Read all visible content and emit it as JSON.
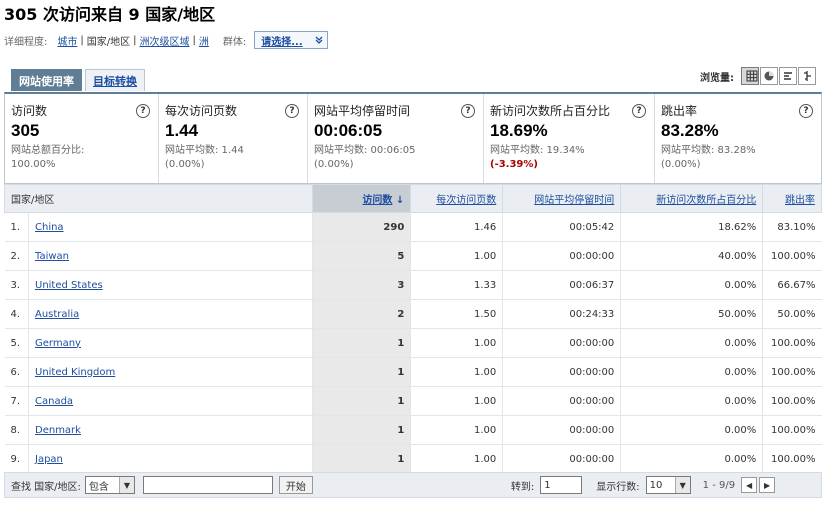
{
  "header": {
    "title": "305 次访问来自 9 国家/地区",
    "detail_label": "详细程度:",
    "levels": [
      "城市",
      "国家/地区",
      "洲次级区域",
      "洲"
    ],
    "segment_label": "群体:",
    "segment_value": "请选择..."
  },
  "tabs": [
    "网站使用率",
    "目标转换"
  ],
  "view_label": "浏览量:",
  "metrics": [
    {
      "name": "访问数",
      "value": "305",
      "sub1": "网站总额百分比:",
      "sub2": "100.00%"
    },
    {
      "name": "每次访问页数",
      "value": "1.44",
      "sub1": "网站平均数: 1.44",
      "sub2": "(0.00%)"
    },
    {
      "name": "网站平均停留时间",
      "value": "00:06:05",
      "sub1": "网站平均数: 00:06:05",
      "sub2": "(0.00%)"
    },
    {
      "name": "新访问次数所占百分比",
      "value": "18.69%",
      "sub1": "网站平均数: 19.34%",
      "sub2": "(-3.39%)"
    },
    {
      "name": "跳出率",
      "value": "83.28%",
      "sub1": "网站平均数: 83.28%",
      "sub2": "(0.00%)"
    }
  ],
  "table": {
    "columns": [
      "国家/地区",
      "访问数",
      "每次访问页数",
      "网站平均停留时间",
      "新访问次数所占百分比",
      "跳出率"
    ],
    "rows": [
      {
        "idx": "1.",
        "country": "China",
        "visits": "290",
        "pages": "1.46",
        "time": "00:05:42",
        "new": "18.62%",
        "bounce": "83.10%"
      },
      {
        "idx": "2.",
        "country": "Taiwan",
        "visits": "5",
        "pages": "1.00",
        "time": "00:00:00",
        "new": "40.00%",
        "bounce": "100.00%"
      },
      {
        "idx": "3.",
        "country": "United States",
        "visits": "3",
        "pages": "1.33",
        "time": "00:06:37",
        "new": "0.00%",
        "bounce": "66.67%"
      },
      {
        "idx": "4.",
        "country": "Australia",
        "visits": "2",
        "pages": "1.50",
        "time": "00:24:33",
        "new": "50.00%",
        "bounce": "50.00%"
      },
      {
        "idx": "5.",
        "country": "Germany",
        "visits": "1",
        "pages": "1.00",
        "time": "00:00:00",
        "new": "0.00%",
        "bounce": "100.00%"
      },
      {
        "idx": "6.",
        "country": "United Kingdom",
        "visits": "1",
        "pages": "1.00",
        "time": "00:00:00",
        "new": "0.00%",
        "bounce": "100.00%"
      },
      {
        "idx": "7.",
        "country": "Canada",
        "visits": "1",
        "pages": "1.00",
        "time": "00:00:00",
        "new": "0.00%",
        "bounce": "100.00%"
      },
      {
        "idx": "8.",
        "country": "Denmark",
        "visits": "1",
        "pages": "1.00",
        "time": "00:00:00",
        "new": "0.00%",
        "bounce": "100.00%"
      },
      {
        "idx": "9.",
        "country": "Japan",
        "visits": "1",
        "pages": "1.00",
        "time": "00:00:00",
        "new": "0.00%",
        "bounce": "100.00%"
      }
    ]
  },
  "footer": {
    "search_label": "查找 国家/地区:",
    "match_option": "包含",
    "search_value": "",
    "go_label": "开始",
    "goto_label": "转到:",
    "goto_value": "1",
    "rows_label": "显示行数:",
    "rows_value": "10",
    "range": "1 - 9/9"
  }
}
